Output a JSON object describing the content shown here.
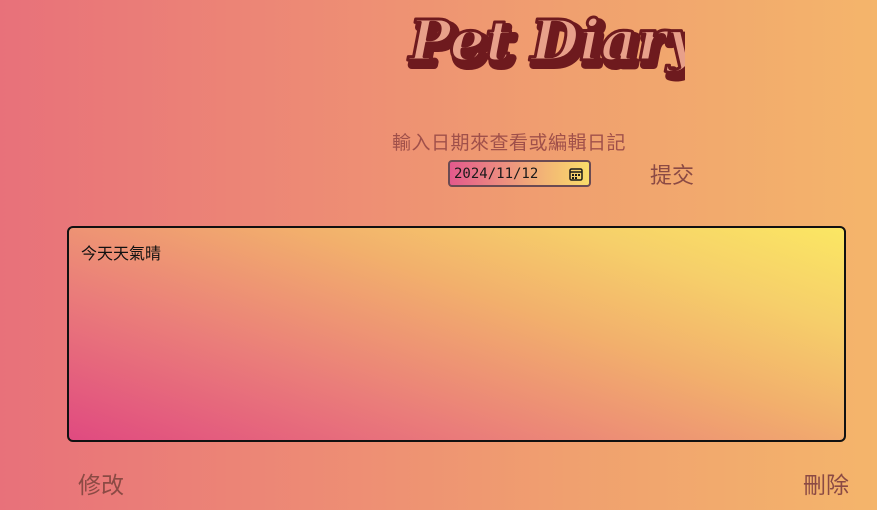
{
  "header": {
    "logo_text": "Pet Diary"
  },
  "date_picker": {
    "prompt": "輸入日期來查看或編輯日記",
    "value": "2024/11/12",
    "icon": "calendar-icon"
  },
  "actions": {
    "submit_label": "提交",
    "edit_label": "修改",
    "delete_label": "刪除"
  },
  "diary": {
    "content": "今天天氣晴"
  },
  "colors": {
    "logo_fill": "#e8a08a",
    "logo_outline": "#6e1a1e",
    "button_text": "#8b4a44",
    "prompt_text": "#a0504a"
  }
}
